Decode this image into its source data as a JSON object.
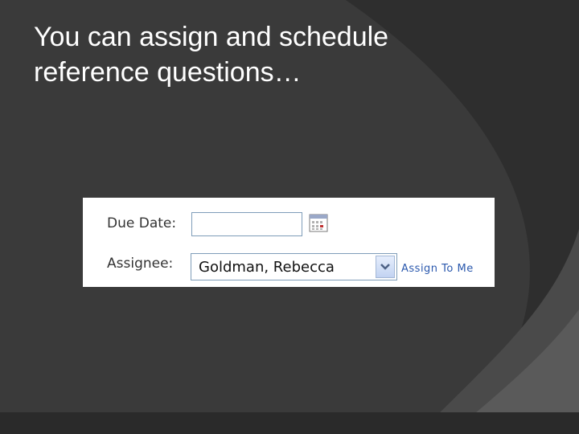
{
  "slide": {
    "title_line1": "You can assign and schedule",
    "title_line2": "reference questions…"
  },
  "form": {
    "due_date": {
      "label": "Due Date:",
      "value": "",
      "icon": "calendar-icon"
    },
    "assignee": {
      "label": "Assignee:",
      "selected": "Goldman, Rebecca",
      "icon": "chevron-down-icon"
    },
    "assign_to_me_link": "Assign To Me"
  },
  "colors": {
    "background": "#3a3a3a",
    "decor_dark": "#2e2e2e",
    "decor_light": "#5a5a5a",
    "title_text": "#ffffff",
    "panel": "#ffffff",
    "link": "#2a58ad",
    "input_border": "#7f9db9"
  }
}
